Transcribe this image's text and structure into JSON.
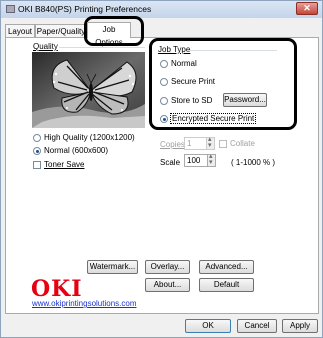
{
  "window": {
    "title": "OKI B840(PS) Printing Preferences",
    "close": "✕"
  },
  "tabs": [
    {
      "label": "Layout"
    },
    {
      "label": "Paper/Quality"
    },
    {
      "label": "Job Options"
    }
  ],
  "quality": {
    "label": "Quality",
    "options": [
      {
        "label": "High Quality (1200x1200)",
        "selected": false
      },
      {
        "label": "Normal (600x600)",
        "selected": true
      }
    ],
    "toner_save": {
      "label": "Toner Save",
      "checked": false
    }
  },
  "job_type": {
    "label": "Job Type",
    "options": [
      {
        "label": "Normal",
        "selected": false
      },
      {
        "label": "Secure Print",
        "selected": false
      },
      {
        "label": "Store to SD",
        "selected": false
      },
      {
        "label": "Encrypted Secure Print",
        "selected": true
      }
    ],
    "password_button": "Password..."
  },
  "copies": {
    "label": "Copies",
    "value": "1",
    "collate_label": "Collate",
    "enabled": false
  },
  "scale": {
    "label": "Scale",
    "value": "100",
    "range": "( 1-1000 % )"
  },
  "buttons": {
    "watermark": "Watermark...",
    "overlay": "Overlay...",
    "advanced": "Advanced...",
    "about": "About...",
    "default": "Default"
  },
  "branding": {
    "logo": "OKI",
    "url": "www.okiprintingsolutions.com"
  },
  "footer": {
    "ok": "OK",
    "cancel": "Cancel",
    "apply": "Apply"
  },
  "colors": {
    "accent": "#1f4f8c",
    "logo_red": "#e60012",
    "link_blue": "#1a33cc"
  }
}
